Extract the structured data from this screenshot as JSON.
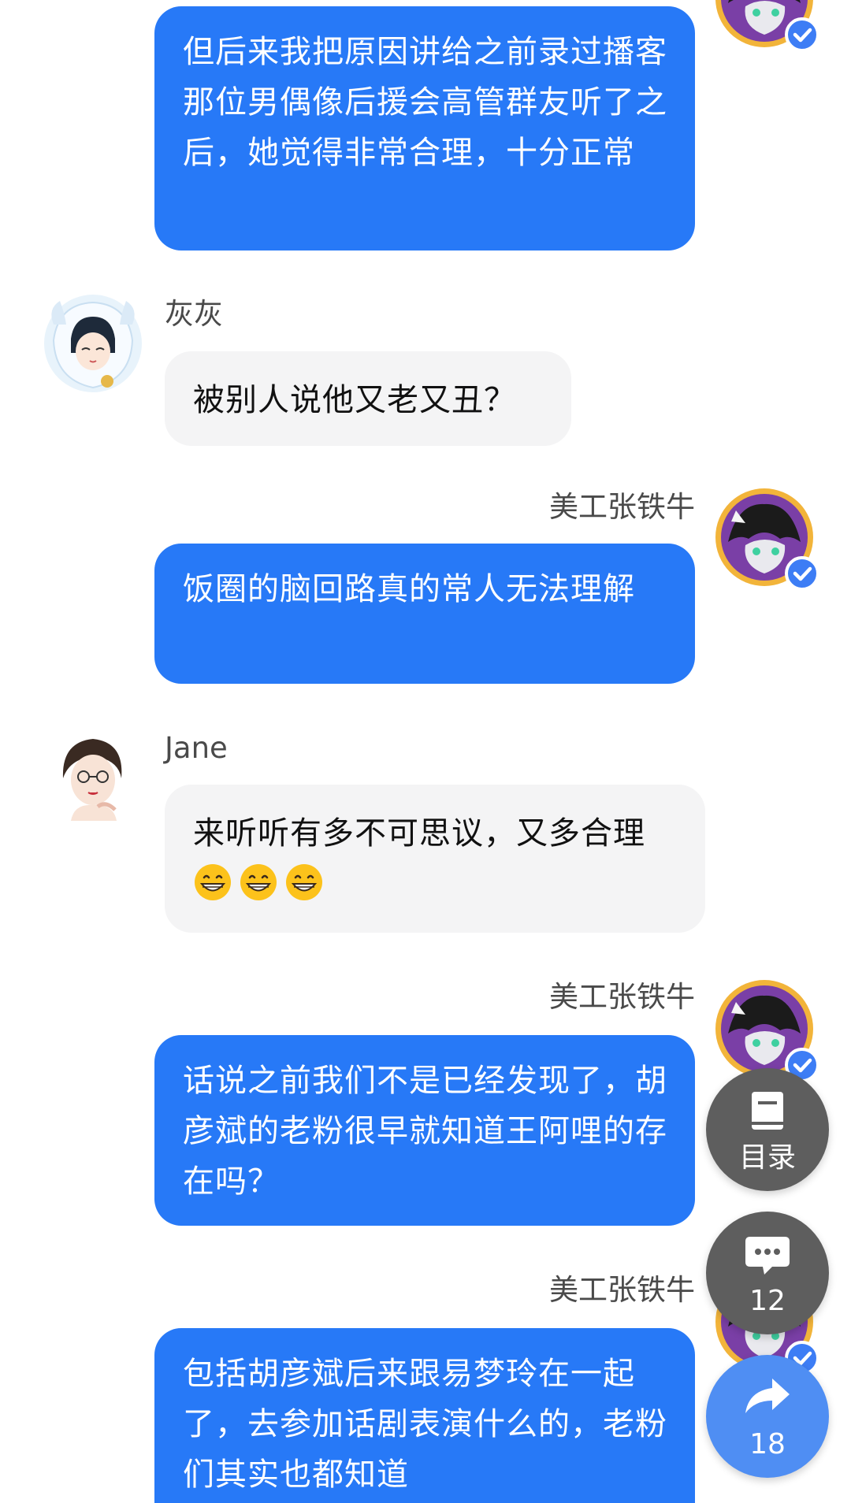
{
  "messages": [
    {
      "side": "right",
      "sender": "",
      "text": "但后来我把原因讲给之前录过播客那位男偶像后援会高管群友听了之后，她觉得非常合理，十分正常"
    },
    {
      "side": "left",
      "sender": "灰灰",
      "text": "被别人说他又老又丑？"
    },
    {
      "side": "right",
      "sender": "美工张铁牛",
      "text": "饭圈的脑回路真的常人无法理解"
    },
    {
      "side": "left",
      "sender": "Jane",
      "text": "来听听有多不可思议，又多合理",
      "emojis": [
        "grinning-face",
        "grinning-face",
        "grinning-face"
      ]
    },
    {
      "side": "right",
      "sender": "美工张铁牛",
      "text": "话说之前我们不是已经发现了，胡彦斌的老粉很早就知道王阿哩的存在吗？"
    },
    {
      "side": "right",
      "sender": "美工张铁牛",
      "text": "包括胡彦斌后来跟易梦玲在一起了，去参加话剧表演什么的，老粉们其实也都知道"
    }
  ],
  "floating_actions": {
    "toc": {
      "label": "目录",
      "icon": "book-icon"
    },
    "comments": {
      "count": "12",
      "icon": "comment-icon"
    },
    "share": {
      "count": "18",
      "icon": "share-icon"
    }
  },
  "colors": {
    "outgoing_bubble": "#2779f7",
    "incoming_bubble": "#f4f4f5",
    "fab_dark": "#5e5e5e",
    "fab_blue": "#4f8ef3",
    "verified_badge": "#3d7df5"
  }
}
